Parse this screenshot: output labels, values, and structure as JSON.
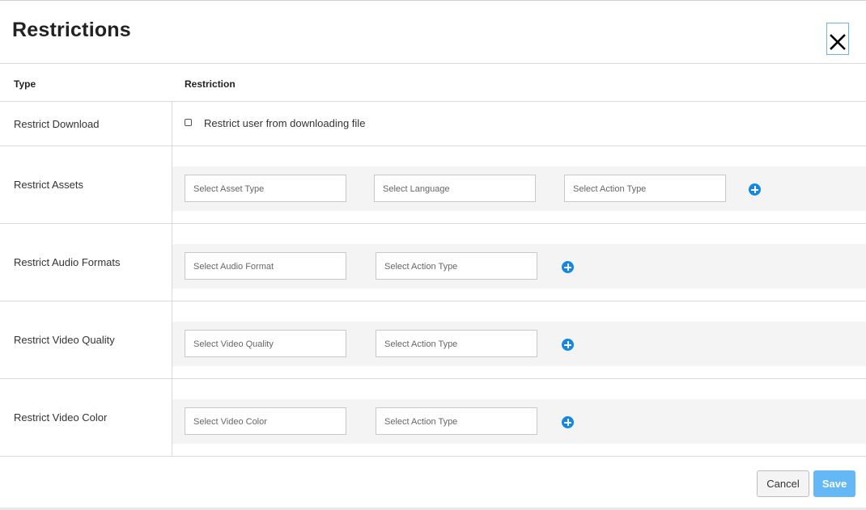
{
  "dialog": {
    "title": "Restrictions",
    "close_icon": "close-icon"
  },
  "table": {
    "headers": {
      "type": "Type",
      "restriction": "Restriction"
    },
    "rows": [
      {
        "label": "Restrict Download",
        "checkbox": {
          "label": "Restrict user from downloading file",
          "checked": false
        }
      },
      {
        "label": "Restrict Assets",
        "selects": [
          "Select Asset Type",
          "Select Language",
          "Select Action Type"
        ]
      },
      {
        "label": "Restrict Audio Formats",
        "selects": [
          "Select Audio Format",
          "Select Action Type"
        ]
      },
      {
        "label": "Restrict Video Quality",
        "selects": [
          "Select Video Quality",
          "Select Action Type"
        ]
      },
      {
        "label": "Restrict Video Color",
        "selects": [
          "Select Video Color",
          "Select Action Type"
        ]
      }
    ]
  },
  "footer": {
    "cancel_label": "Cancel",
    "save_label": "Save"
  },
  "colors": {
    "accent": "#1488e0",
    "save_button": "#63b8f5",
    "row_band": "#f4f4f4"
  }
}
